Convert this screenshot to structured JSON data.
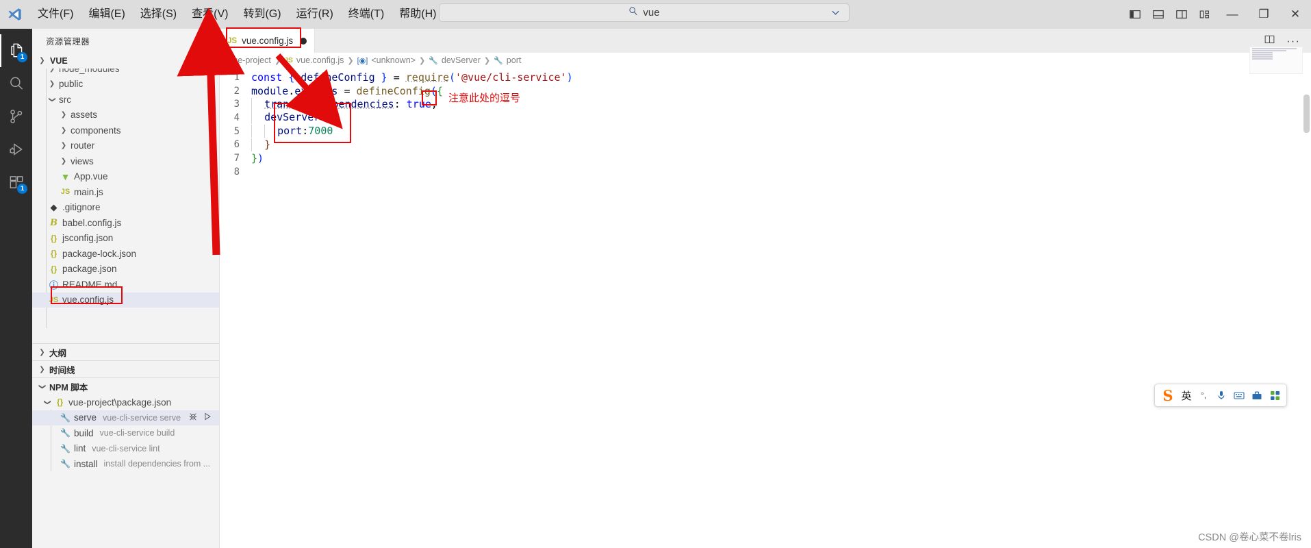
{
  "titlebar": {
    "logo_icon": "vscode-logo-icon",
    "menus": [
      {
        "label": "文件(F)"
      },
      {
        "label": "编辑(E)"
      },
      {
        "label": "选择(S)"
      },
      {
        "label": "查看(V)"
      },
      {
        "label": "转到(G)"
      },
      {
        "label": "运行(R)"
      },
      {
        "label": "终端(T)"
      },
      {
        "label": "帮助(H)"
      }
    ],
    "back_icon": "arrow-left-icon",
    "forward_icon": "arrow-right-icon",
    "command_center": {
      "search_icon": "search-icon",
      "value": "vue",
      "chevron_icon": "chevron-down-icon"
    },
    "layout_buttons": [
      {
        "name": "toggle-primary-sidebar",
        "icon": "layout-sidebar-left-icon"
      },
      {
        "name": "toggle-panel",
        "icon": "layout-panel-icon"
      },
      {
        "name": "toggle-secondary-sidebar",
        "icon": "layout-sidebar-right-icon"
      },
      {
        "name": "customize-layout",
        "icon": "layout-grid-icon"
      }
    ],
    "window_buttons": [
      {
        "name": "minimize",
        "label": "—"
      },
      {
        "name": "restore",
        "label": "❐"
      },
      {
        "name": "close",
        "label": "✕"
      }
    ]
  },
  "activitybar": {
    "items": [
      {
        "name": "explorer",
        "icon": "files-icon",
        "badge": "1",
        "active": true
      },
      {
        "name": "search",
        "icon": "search-icon",
        "badge": "",
        "active": false
      },
      {
        "name": "source-control",
        "icon": "source-control-icon",
        "badge": "",
        "active": false
      },
      {
        "name": "run-and-debug",
        "icon": "run-debug-icon",
        "badge": "",
        "active": false
      },
      {
        "name": "extensions",
        "icon": "extensions-icon",
        "badge": "1",
        "active": false
      }
    ]
  },
  "sidebar": {
    "title": "资源管理器",
    "more_actions": "···",
    "root": {
      "label": "VUE",
      "expanded": true
    },
    "files": [
      {
        "label": "node_modules",
        "type": "folder",
        "expanded": false,
        "indent": 1,
        "icon": "chevron-right-icon",
        "clipped": true
      },
      {
        "label": "public",
        "type": "folder",
        "expanded": false,
        "indent": 1,
        "icon": "chevron-right-icon"
      },
      {
        "label": "src",
        "type": "folder",
        "expanded": true,
        "indent": 1,
        "icon": "chevron-down-icon"
      },
      {
        "label": "assets",
        "type": "folder",
        "expanded": false,
        "indent": 2,
        "icon": "chevron-right-icon"
      },
      {
        "label": "components",
        "type": "folder",
        "expanded": false,
        "indent": 2,
        "icon": "chevron-right-icon"
      },
      {
        "label": "router",
        "type": "folder",
        "expanded": false,
        "indent": 2,
        "icon": "chevron-right-icon"
      },
      {
        "label": "views",
        "type": "folder",
        "expanded": false,
        "indent": 2,
        "icon": "chevron-right-icon"
      },
      {
        "label": "App.vue",
        "type": "file",
        "indent": 2,
        "icon": "vue-file-icon"
      },
      {
        "label": "main.js",
        "type": "file",
        "indent": 2,
        "icon": "js-file-icon"
      },
      {
        "label": ".gitignore",
        "type": "file",
        "indent": 1,
        "icon": "git-file-icon"
      },
      {
        "label": "babel.config.js",
        "type": "file",
        "indent": 1,
        "icon": "babel-file-icon"
      },
      {
        "label": "jsconfig.json",
        "type": "file",
        "indent": 1,
        "icon": "json-file-icon"
      },
      {
        "label": "package-lock.json",
        "type": "file",
        "indent": 1,
        "icon": "json-file-icon"
      },
      {
        "label": "package.json",
        "type": "file",
        "indent": 1,
        "icon": "json-file-icon"
      },
      {
        "label": "README.md",
        "type": "file",
        "indent": 1,
        "icon": "markdown-file-icon"
      },
      {
        "label": "vue.config.js",
        "type": "file",
        "indent": 1,
        "icon": "js-file-icon",
        "selected": true
      }
    ],
    "panels": [
      {
        "label": "大纲",
        "expanded": false
      },
      {
        "label": "时间线",
        "expanded": false
      },
      {
        "label": "NPM 脚本",
        "expanded": true
      }
    ],
    "npm": {
      "package": "vue-project\\package.json",
      "scripts": [
        {
          "name": "serve",
          "command": "vue-cli-service serve",
          "selected": true,
          "debug_icon": "debug-bug-icon",
          "run_icon": "run-play-icon"
        },
        {
          "name": "build",
          "command": "vue-cli-service build",
          "selected": false
        },
        {
          "name": "lint",
          "command": "vue-cli-service lint",
          "selected": false
        },
        {
          "name": "install",
          "command": "install dependencies from ...",
          "selected": false
        }
      ]
    }
  },
  "editor": {
    "tab": {
      "icon": "js-file-icon",
      "icon_label": "JS",
      "label": "vue.config.js",
      "dirty": true
    },
    "tab_actions": [
      {
        "name": "split-editor",
        "icon": "split-editor-icon"
      },
      {
        "name": "more-actions",
        "icon": "ellipsis-icon"
      }
    ],
    "breadcrumb": [
      {
        "label": "vue-project",
        "icon": ""
      },
      {
        "label": "vue.config.js",
        "icon": "js-file-icon",
        "icon_label": "JS"
      },
      {
        "label": "<unknown>",
        "icon": "symbol-object-icon"
      },
      {
        "label": "devServer",
        "icon": "symbol-property-icon"
      },
      {
        "label": "port",
        "icon": "symbol-property-icon"
      }
    ],
    "code_lines": [
      {
        "num": "1",
        "text": "const { defineConfig } = require('@vue/cli-service')"
      },
      {
        "num": "2",
        "text": "module.exports = defineConfig({"
      },
      {
        "num": "3",
        "text": "  transpileDependencies: true,"
      },
      {
        "num": "4",
        "text": "  devServer:{"
      },
      {
        "num": "5",
        "text": "    port:7000"
      },
      {
        "num": "6",
        "text": "  }"
      },
      {
        "num": "7",
        "text": "})"
      },
      {
        "num": "8",
        "text": ""
      }
    ]
  },
  "annotations": {
    "comma_note": "注意此处的逗号",
    "boxes": [
      {
        "name": "tab-highlight-box"
      },
      {
        "name": "file-highlight-box"
      },
      {
        "name": "comma-highlight-box"
      },
      {
        "name": "devserver-block-box"
      }
    ],
    "arrow_color": "#e10b0b"
  },
  "ime": {
    "logo_label": "S",
    "language_label": "英",
    "buttons": [
      {
        "name": "punctuation-toggle",
        "icon": "punctuation-icon",
        "label": "°,"
      },
      {
        "name": "voice-input",
        "icon": "microphone-icon"
      },
      {
        "name": "soft-keyboard",
        "icon": "keyboard-icon"
      },
      {
        "name": "toolbox",
        "icon": "toolbox-icon"
      },
      {
        "name": "app-grid",
        "icon": "grid-icon"
      }
    ]
  },
  "watermark": "CSDN @卷心菜不卷lris"
}
